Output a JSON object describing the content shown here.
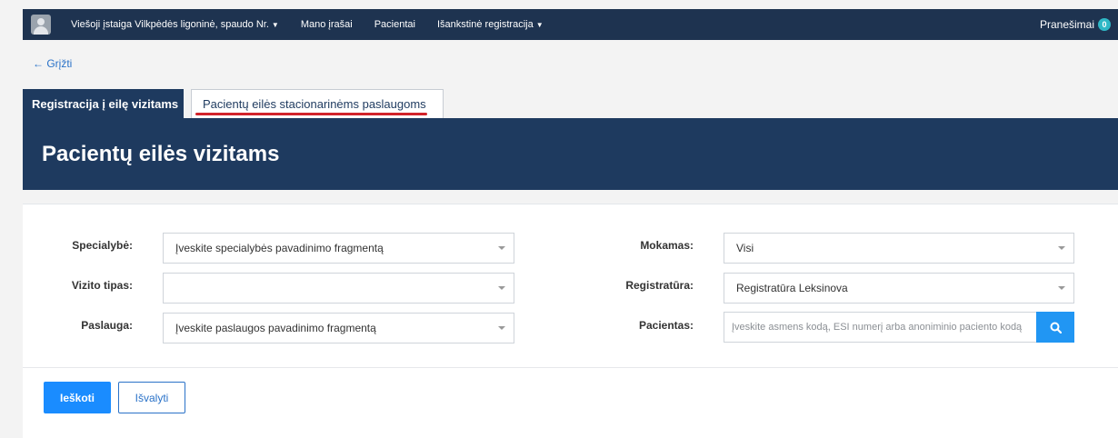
{
  "nav": {
    "org": "Viešoji įstaiga Vilkpėdės ligoninė, spaudo Nr.",
    "my_records": "Mano įrašai",
    "patients": "Pacientai",
    "pre_registration": "Išankstinė registracija",
    "notifications": "Pranešimai",
    "notifications_count": "0"
  },
  "back_link": "← Grįžti",
  "tabs": {
    "active": "Registracija į eilę vizitams",
    "other": "Pacientų eilės stacionarinėms paslaugoms"
  },
  "page_title": "Pacientų eilės vizitams",
  "form": {
    "specialty_label": "Specialybė:",
    "specialty_value": "Įveskite specialybės pavadinimo fragmentą",
    "visit_type_label": "Vizito tipas:",
    "visit_type_value": "",
    "service_label": "Paslauga:",
    "service_value": "Įveskite paslaugos pavadinimo fragmentą",
    "paid_label": "Mokamas:",
    "paid_value": "Visi",
    "registry_label": "Registratūra:",
    "registry_value": "Registratūra Leksinova",
    "patient_label": "Pacientas:",
    "patient_placeholder": "Įveskite asmens kodą, ESI numerį arba anoniminio paciento kodą"
  },
  "buttons": {
    "search": "Ieškoti",
    "clear": "Išvalyti"
  },
  "colors": {
    "navbar": "#1e3350",
    "banner": "#1e3a5f",
    "primary": "#1a8cff",
    "annotation": "#d2232a"
  }
}
